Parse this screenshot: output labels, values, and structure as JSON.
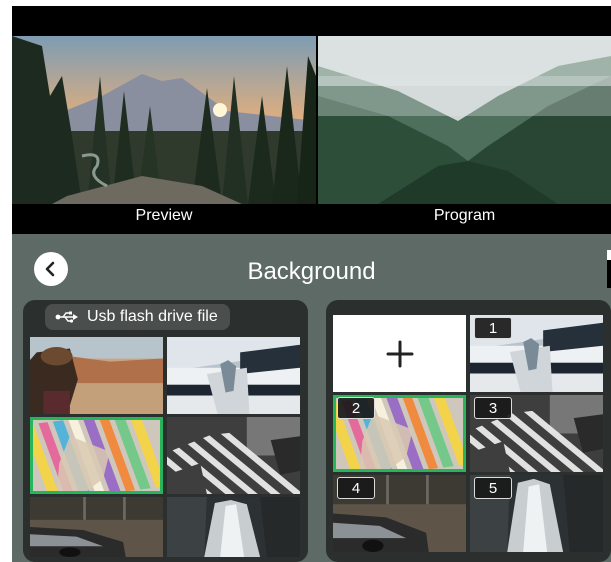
{
  "monitors": {
    "preview_label": "Preview",
    "program_label": "Program"
  },
  "panel": {
    "title": "Background",
    "back_icon": "chevron-left-icon"
  },
  "source": {
    "label": "Usb flash drive file",
    "icon": "usb-icon",
    "thumbnails": [
      "desert-person",
      "modern-building",
      "colorful-stripes",
      "striped-hand",
      "car-dashboard",
      "waterfall"
    ],
    "selected_index": 2
  },
  "slots": {
    "add_icon": "plus-icon",
    "items": [
      {
        "number": "1",
        "image": "modern-building"
      },
      {
        "number": "2",
        "image": "colorful-stripes"
      },
      {
        "number": "3",
        "image": "striped-hand"
      },
      {
        "number": "4",
        "image": "car-dashboard"
      },
      {
        "number": "5",
        "image": "waterfall"
      }
    ],
    "selected_number": "2"
  },
  "colors": {
    "panel_bg": "#5d6a66",
    "box_bg": "#2b2f2e",
    "selection": "#27b45a"
  }
}
